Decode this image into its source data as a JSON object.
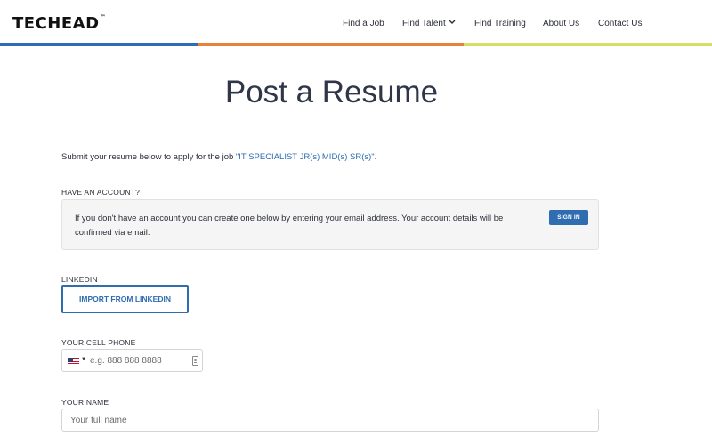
{
  "header": {
    "logo": "TECHEAD",
    "logo_tm": "™",
    "nav": [
      {
        "label": "Find a Job"
      },
      {
        "label": "Find Talent",
        "has_dropdown": true
      },
      {
        "label": "Find Training"
      },
      {
        "label": "About Us"
      },
      {
        "label": "Contact Us"
      }
    ],
    "stripe_colors": [
      "#2f6db0",
      "#e8823b",
      "#d8de63"
    ]
  },
  "page": {
    "title": "Post a Resume",
    "intro_prefix": "Submit your resume below to apply for the job ",
    "intro_job": "\"IT SPECIALIST JR(s) MID(s) SR(s)\"",
    "intro_suffix": "."
  },
  "account": {
    "label": "HAVE AN ACCOUNT?",
    "text": "If you don't have an account you can create one below by entering your email address. Your account details will be confirmed via email.",
    "signin_label": "SIGN IN"
  },
  "linkedin": {
    "label": "LINKEDIN",
    "button_label": "IMPORT FROM LINKEDIN"
  },
  "phone": {
    "label": "YOUR CELL PHONE",
    "country": "US",
    "value": "",
    "placeholder": "e.g. 888 888 8888"
  },
  "name": {
    "label": "YOUR NAME",
    "value": "",
    "placeholder": "Your full name"
  },
  "colors": {
    "accent": "#2f6db0",
    "title": "#2e3648",
    "box_bg": "#f5f5f5"
  }
}
